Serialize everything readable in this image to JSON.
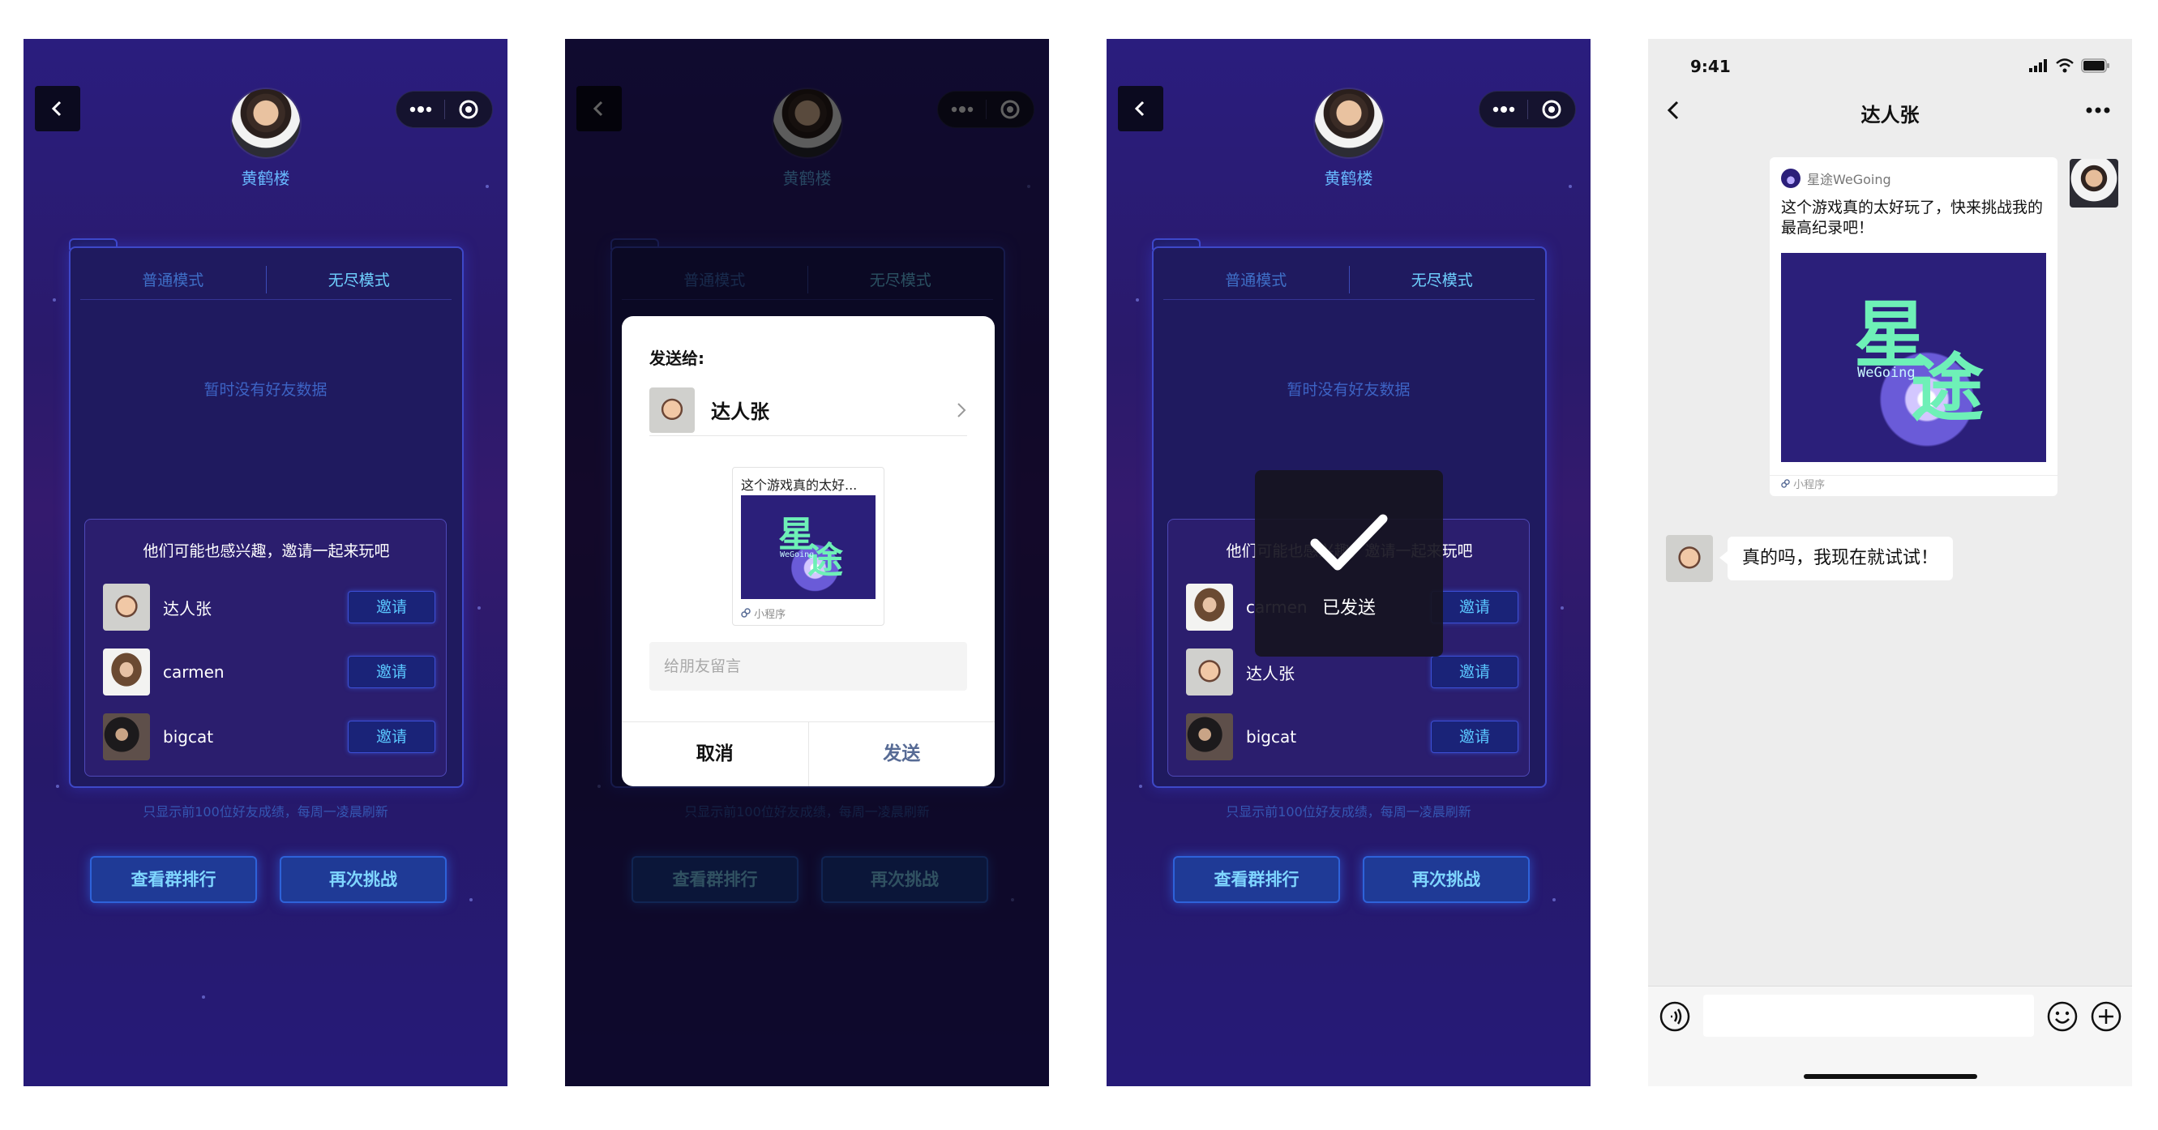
{
  "nav": {
    "back_icon": "chevron-left-icon",
    "more_icon": "more-dots-icon",
    "close_icon": "target-circle-icon"
  },
  "profile": {
    "name": "黄鹤楼"
  },
  "tabs": {
    "normal": "普通模式",
    "endless": "无尽模式"
  },
  "empty_text": "暂时没有好友数据",
  "invite_panel": {
    "title": "他们可能也感兴趣，邀请一起来玩吧",
    "invite_label": "邀请",
    "screen1_friends": [
      {
        "name": "达人张"
      },
      {
        "name": "carmen"
      },
      {
        "name": "bigcat"
      }
    ],
    "screen3_friends": [
      {
        "name": "carmen"
      },
      {
        "name": "达人张"
      },
      {
        "name": "bigcat"
      }
    ]
  },
  "footnote": "只显示前100位好友成绩，每周一凌晨刷新",
  "buttons": {
    "group_rank": "查看群排行",
    "retry": "再次挑战"
  },
  "share_dialog": {
    "title": "发送给:",
    "recipient": "达人张",
    "card_text": "这个游戏真的太好...",
    "card_tag": "小程序",
    "message_placeholder": "给朋友留言",
    "cancel": "取消",
    "send": "发送"
  },
  "cover": {
    "title_line1": "星",
    "title_line2": "途",
    "subtitle": "WeGoing"
  },
  "toast": {
    "text": "已发送",
    "icon": "checkmark-icon"
  },
  "chat": {
    "time": "9:41",
    "title": "达人张",
    "card_app": "星途WeGoing",
    "card_text": "这个游戏真的太好玩了，快来挑战我的最高纪录吧！",
    "card_tag": "小程序",
    "reply": "真的吗，我现在就试试！",
    "icons": [
      "signal-icon",
      "wifi-icon",
      "battery-icon",
      "voice-icon",
      "emoji-icon",
      "plus-icon"
    ]
  },
  "colors": {
    "game_bg": "#2a1d7e",
    "accent_cyan": "#6fd1ff",
    "wechat_link": "#576b95",
    "chat_bg": "#ededed"
  }
}
